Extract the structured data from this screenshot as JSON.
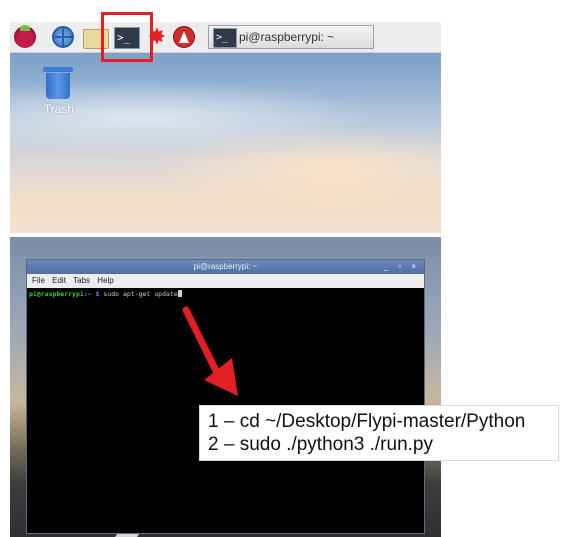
{
  "taskbar": {
    "icons": [
      "raspberry-menu-icon",
      "web-browser-icon",
      "file-manager-icon",
      "terminal-icon",
      "burst-icon",
      "mathematica-icon"
    ],
    "terminal_glyph": ">_",
    "burst_glyph": "✸",
    "task_button_label": "pi@raspberrypi: ~"
  },
  "desktop": {
    "trash_label": "Trash"
  },
  "terminal": {
    "title": "pi@raspberrypi: ~",
    "window_controls": "_ ▫ ×",
    "menu": [
      "File",
      "Edit",
      "Tabs",
      "Help"
    ],
    "prompt_user": "pi@raspberrypi",
    "prompt_path": ":~ $",
    "command": "sudo apt-get update"
  },
  "callout": {
    "line1": "1 – cd ~/Desktop/Flypi-master/Python",
    "line2": "2 – sudo ./python3 ./run.py"
  },
  "colors": {
    "highlight": "#e31e24",
    "arrow": "#e31e24",
    "prompt_user": "#3ec93e",
    "prompt_path": "#5a8cff"
  }
}
